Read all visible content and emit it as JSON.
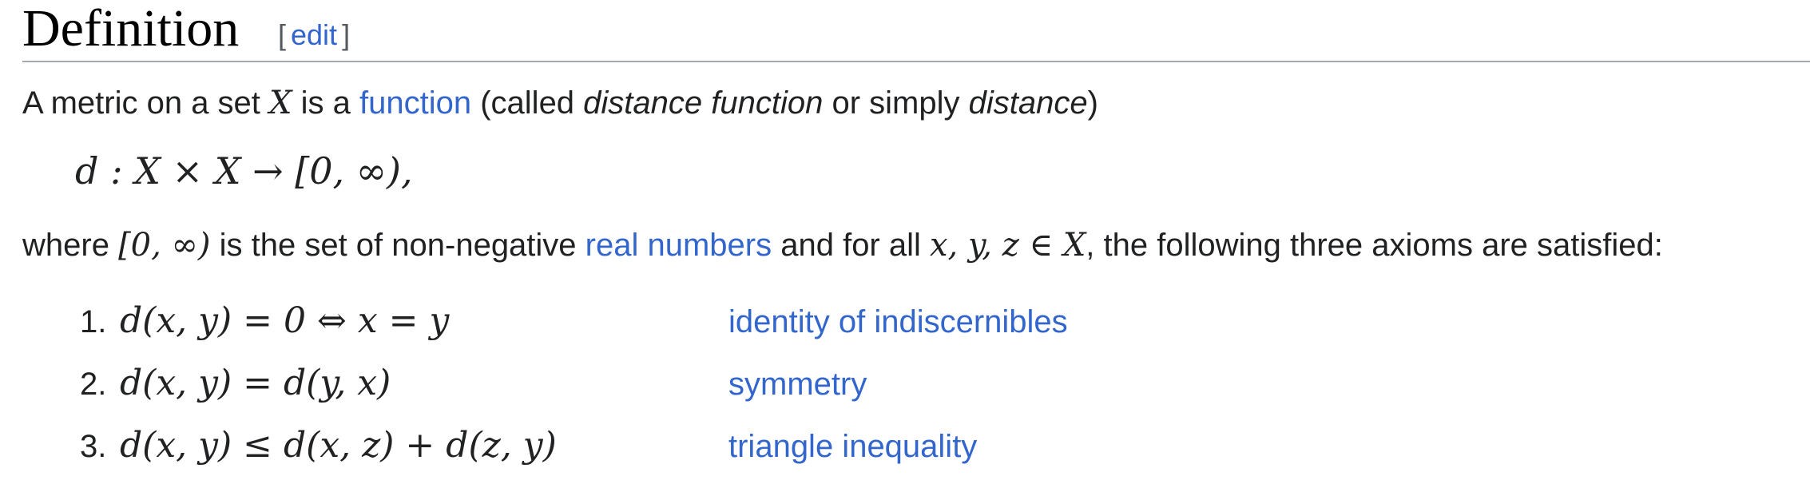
{
  "section": {
    "title": "Definition",
    "edit_open": "[",
    "edit_label": "edit",
    "edit_close": "]"
  },
  "intro": {
    "text1": "A metric on a set ",
    "set_symbol": "X",
    "text2": " is a ",
    "function_link": "function",
    "text3": " (called ",
    "term1": "distance function",
    "text4": " or simply ",
    "term2": "distance",
    "text5": ")"
  },
  "display_formula": "d : X × X → [0, ∞),",
  "where": {
    "text1": "where ",
    "interval": "[0, ∞)",
    "text2": " is the set of non-negative ",
    "real_numbers_link": "real numbers",
    "text3": " and for all ",
    "quantifier": "x, y, z ∈ X",
    "text4": ", the following three axioms are satisfied:"
  },
  "axioms": [
    {
      "number": "1.",
      "formula": "d(x, y) = 0 ⇔ x = y",
      "name": "identity of indiscernibles"
    },
    {
      "number": "2.",
      "formula": "d(x, y) = d(y, x)",
      "name": "symmetry"
    },
    {
      "number": "3.",
      "formula": "d(x, y) ≤ d(x, z) + d(z, y)",
      "name": "triangle inequality"
    }
  ]
}
